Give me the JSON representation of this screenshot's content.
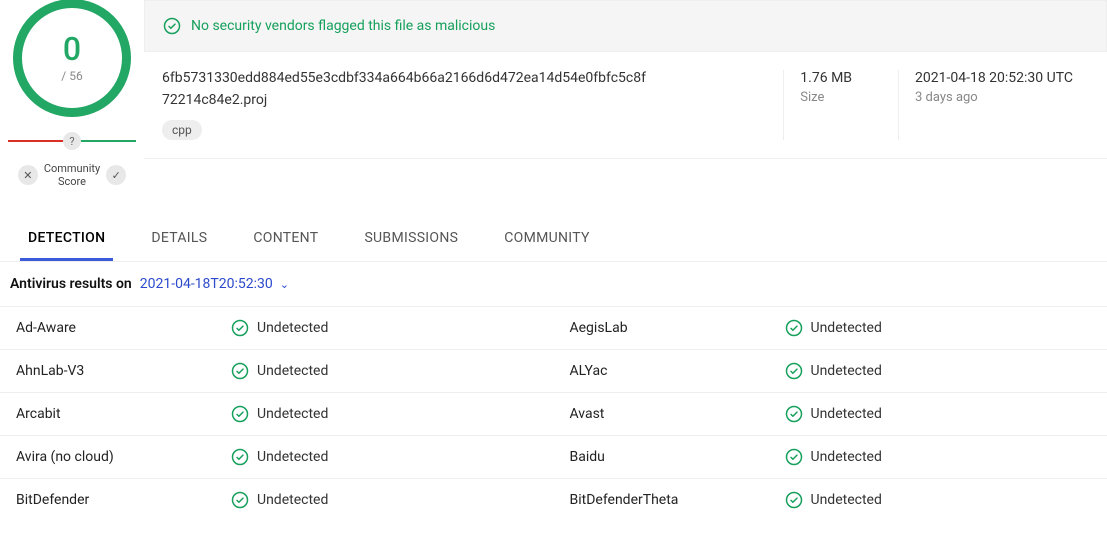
{
  "score": {
    "count": "0",
    "total": "/ 56"
  },
  "community": {
    "label": "Community\nScore"
  },
  "banner": {
    "message": "No security vendors flagged this file as malicious"
  },
  "file": {
    "hash": "6fb5731330edd884ed55e3cdbf334a664b66a2166d6d472ea14d54e0fbfc5c8f",
    "name": "72214c84e2.proj",
    "tag": "cpp",
    "size_val": "1.76 MB",
    "size_lbl": "Size",
    "date_val": "2021-04-18 20:52:30 UTC",
    "date_lbl": "3 days ago"
  },
  "tabs": [
    {
      "label": "DETECTION",
      "active": true
    },
    {
      "label": "DETAILS",
      "active": false
    },
    {
      "label": "CONTENT",
      "active": false
    },
    {
      "label": "SUBMISSIONS",
      "active": false
    },
    {
      "label": "COMMUNITY",
      "active": false
    }
  ],
  "av_header": {
    "label": "Antivirus results on",
    "timestamp": "2021-04-18T20:52:30"
  },
  "av_results": [
    {
      "left": {
        "vendor": "Ad-Aware",
        "status": "Undetected"
      },
      "right": {
        "vendor": "AegisLab",
        "status": "Undetected"
      }
    },
    {
      "left": {
        "vendor": "AhnLab-V3",
        "status": "Undetected"
      },
      "right": {
        "vendor": "ALYac",
        "status": "Undetected"
      }
    },
    {
      "left": {
        "vendor": "Arcabit",
        "status": "Undetected"
      },
      "right": {
        "vendor": "Avast",
        "status": "Undetected"
      }
    },
    {
      "left": {
        "vendor": "Avira (no cloud)",
        "status": "Undetected"
      },
      "right": {
        "vendor": "Baidu",
        "status": "Undetected"
      }
    },
    {
      "left": {
        "vendor": "BitDefender",
        "status": "Undetected"
      },
      "right": {
        "vendor": "BitDefenderTheta",
        "status": "Undetected"
      }
    }
  ]
}
